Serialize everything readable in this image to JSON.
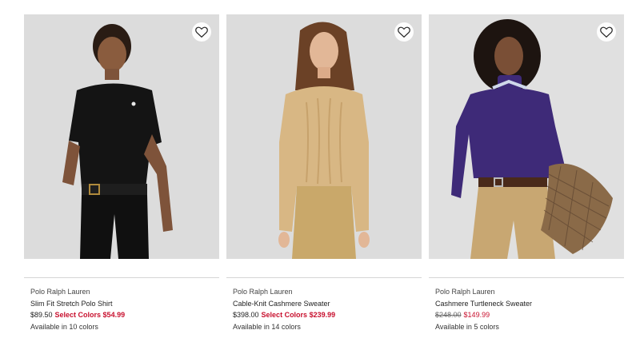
{
  "products": [
    {
      "brand": "Polo Ralph Lauren",
      "name": "Slim Fit Stretch Polo Shirt",
      "price": "$89.50",
      "promo_label": "Select Colors $54.99",
      "availability": "Available in 10 colors",
      "colors": {
        "garment": "#141414",
        "bg": "#dcdcdc"
      }
    },
    {
      "brand": "Polo Ralph Lauren",
      "name": "Cable-Knit Cashmere Sweater",
      "price": "$398.00",
      "promo_label": "Select Colors $239.99",
      "availability": "Available in 14 colors",
      "colors": {
        "garment": "#d8b784",
        "bg": "#dcdcdc"
      }
    },
    {
      "brand": "Polo Ralph Lauren",
      "name": "Cashmere Turtleneck Sweater",
      "original_price": "$248.00",
      "sale_price": "$149.99",
      "availability": "Available in 5 colors",
      "colors": {
        "garment": "#3e2a78",
        "bg": "#e0e0e0"
      }
    }
  ],
  "icons": {
    "wishlist": "heart-outline-icon"
  },
  "accent_color": "#c8102e"
}
